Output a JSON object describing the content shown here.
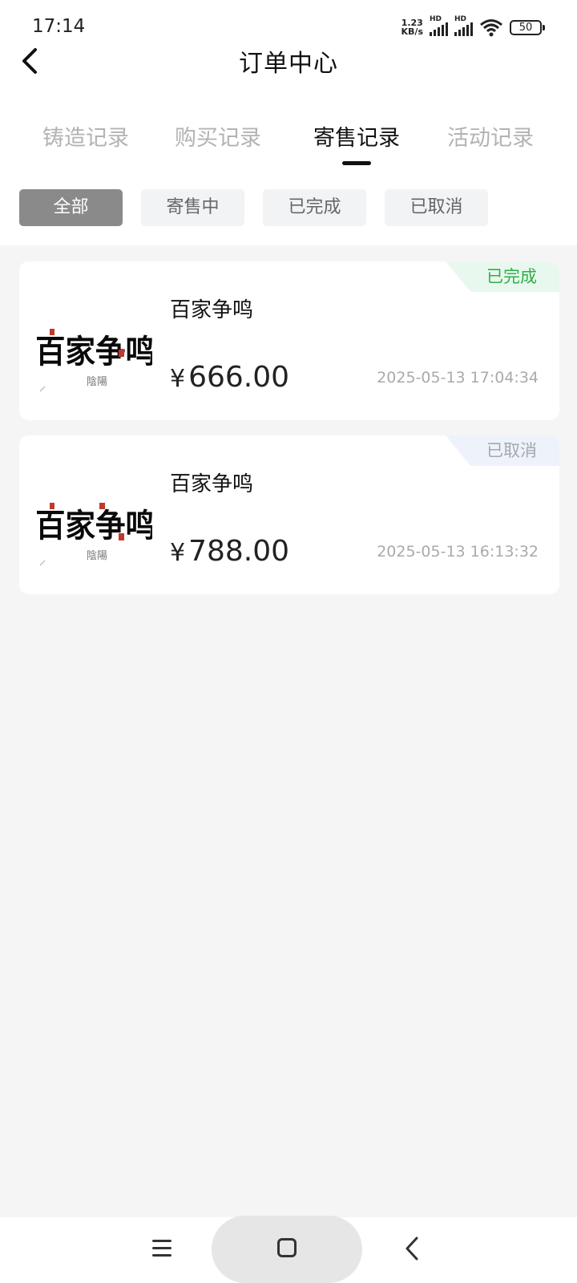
{
  "status_bar": {
    "time": "17:14",
    "net_speed_value": "1.23",
    "net_speed_unit": "KB/s",
    "sim1_label": "HD",
    "sim2_label": "HD",
    "battery": "50"
  },
  "header": {
    "title": "订单中心",
    "back_icon": "chevron-left-icon"
  },
  "tabs": [
    {
      "label": "铸造记录",
      "active": false
    },
    {
      "label": "购买记录",
      "active": false
    },
    {
      "label": "寄售记录",
      "active": true
    },
    {
      "label": "活动记录",
      "active": false
    }
  ],
  "filters": [
    {
      "label": "全部",
      "active": true
    },
    {
      "label": "寄售中",
      "active": false
    },
    {
      "label": "已完成",
      "active": false
    },
    {
      "label": "已取消",
      "active": false
    }
  ],
  "orders": [
    {
      "name": "百家争鸣",
      "currency": "¥",
      "price": "666.00",
      "time": "2025-05-13 17:04:34",
      "status": "已完成",
      "thumbnail_text": "百家争鸣"
    },
    {
      "name": "百家争鸣",
      "currency": "¥",
      "price": "788.00",
      "time": "2025-05-13 16:13:32",
      "status": "已取消",
      "thumbnail_text": "百家争鸣"
    }
  ],
  "colors": {
    "status_done_text": "#2eae49",
    "status_done_bg": "#e9f8ee",
    "status_cancel_text": "#a5a8ad",
    "status_cancel_bg": "#eef2fb",
    "chip_active_bg": "#8a8a8a",
    "page_bg": "#f5f5f5"
  },
  "nav_bar": {
    "menu_icon": "menu-icon",
    "home_icon": "home-square-icon",
    "back_icon": "back-chevron-icon"
  }
}
